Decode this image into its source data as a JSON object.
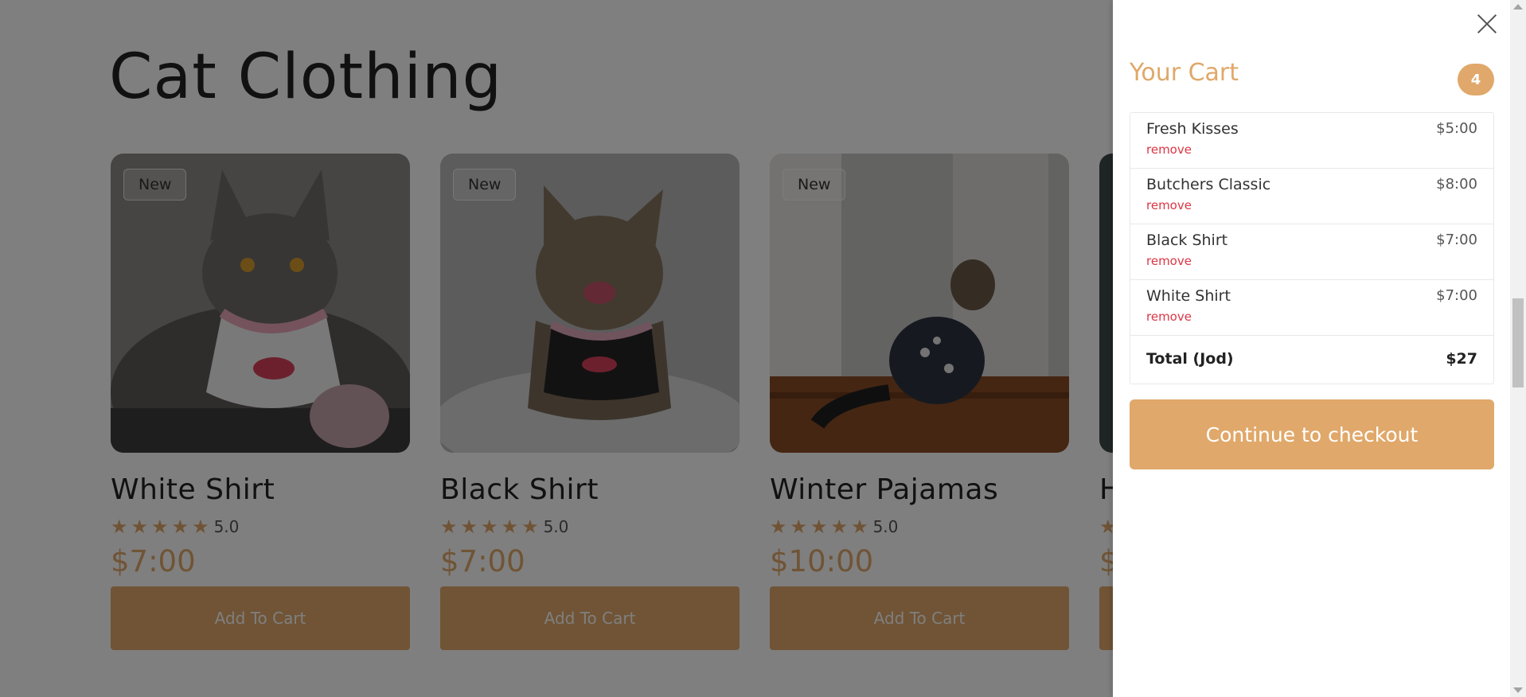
{
  "shop": {
    "section_title": "Cat Clothing",
    "products": [
      {
        "badge": "New",
        "name": "White Shirt",
        "rating": "5.0",
        "price": "$7:00",
        "button_label": "Add To Cart"
      },
      {
        "badge": "New",
        "name": "Black Shirt",
        "rating": "5.0",
        "price": "$7:00",
        "button_label": "Add To Cart"
      },
      {
        "badge": "New",
        "name": "Winter Pajamas",
        "rating": "5.0",
        "price": "$10:00",
        "button_label": "Add To Cart"
      },
      {
        "badge": "",
        "name": "H",
        "rating": "",
        "price": "$",
        "button_label": ""
      }
    ]
  },
  "cart": {
    "title": "Your Cart",
    "count": "4",
    "items": [
      {
        "name": "Fresh Kisses",
        "price": "$5:00",
        "remove_label": "remove"
      },
      {
        "name": "Butchers Classic",
        "price": "$8:00",
        "remove_label": "remove"
      },
      {
        "name": "Black Shirt",
        "price": "$7:00",
        "remove_label": "remove"
      },
      {
        "name": "White Shirt",
        "price": "$7:00",
        "remove_label": "remove"
      }
    ],
    "total_label": "Total (Jod)",
    "total_value": "$27",
    "checkout_label": "Continue to checkout"
  },
  "icons": {
    "close": "close-icon",
    "star": "star-icon"
  },
  "colors": {
    "accent": "#e0a86a",
    "remove": "#dc3545",
    "overlay": "rgba(0,0,0,0.5)"
  }
}
